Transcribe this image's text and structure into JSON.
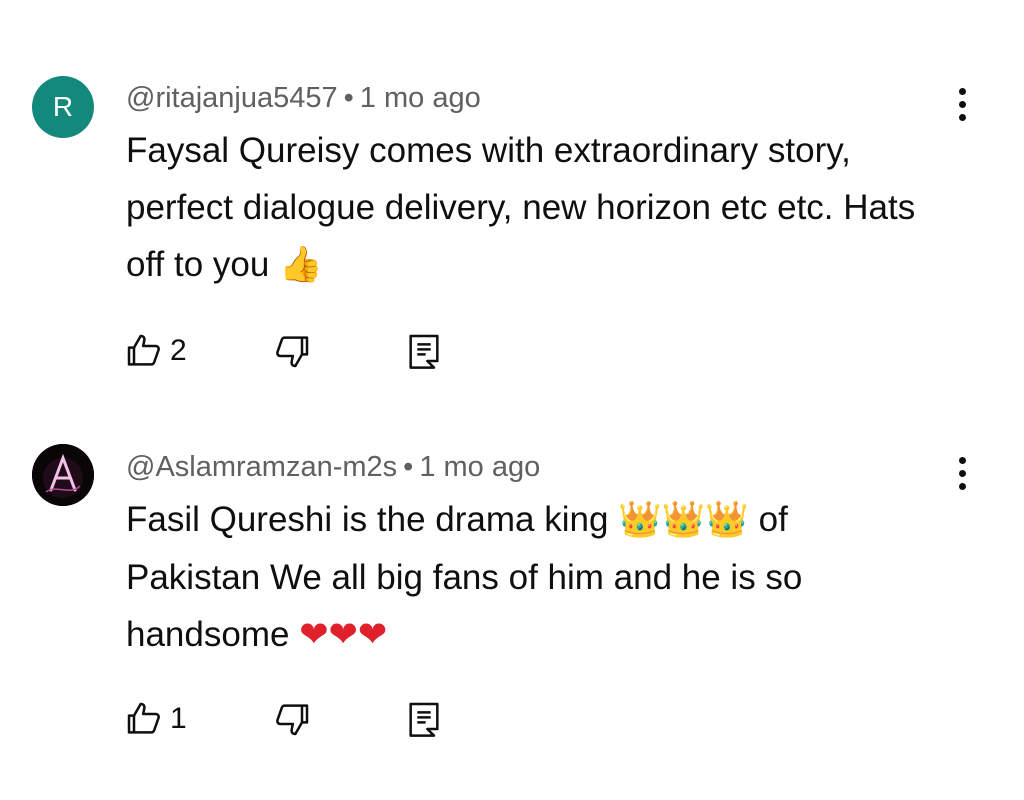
{
  "comments": [
    {
      "avatar_letter": "R",
      "avatar_color": "#12897a",
      "author": "@ritajanjua5457",
      "separator": "•",
      "time": "1 mo ago",
      "text": "Faysal Qureisy comes with extraordinary story, perfect dialogue delivery, new horizon etc etc. Hats off to you",
      "emoji": "👍",
      "like_count": "2",
      "icons": {
        "like": "thumbs-up-outline-icon",
        "dislike": "thumbs-down-outline-icon",
        "reply": "reply-comment-icon",
        "menu": "more-vertical-icon"
      }
    },
    {
      "avatar_letter": "A",
      "avatar_color": "#0a0608",
      "author": "@Aslamramzan-m2s",
      "separator": "•",
      "time": "1 mo ago",
      "text_part1": "Fasil Qureshi is the drama king",
      "crowns": "👑👑👑",
      "text_part2": "of Pakistan We all big fans of him and he is so handsome",
      "hearts": "❤❤❤",
      "like_count": "1",
      "icons": {
        "like": "thumbs-up-outline-icon",
        "dislike": "thumbs-down-outline-icon",
        "reply": "reply-comment-icon",
        "menu": "more-vertical-icon"
      }
    }
  ],
  "colors": {
    "meta_text": "#606060",
    "body_text": "#0f0f0f",
    "heart": "#e0202a"
  }
}
